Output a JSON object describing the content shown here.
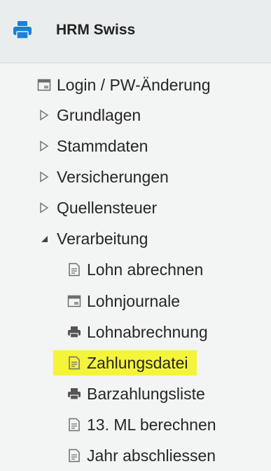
{
  "header": {
    "app_icon": "printer-icon",
    "title": "HRM Swiss",
    "accent_color": "#1f7fd6"
  },
  "menu": {
    "items": [
      {
        "label": "Login / PW-Änderung",
        "icon": "window-icon"
      },
      {
        "label": "Grundlagen",
        "icon": "triangle-right-icon"
      },
      {
        "label": "Stammdaten",
        "icon": "triangle-right-icon"
      },
      {
        "label": "Versicherungen",
        "icon": "triangle-right-icon"
      },
      {
        "label": "Quellensteuer",
        "icon": "triangle-right-icon"
      },
      {
        "label": "Verarbeitung",
        "icon": "triangle-down-icon",
        "expanded": true
      }
    ],
    "subitems": [
      {
        "label": "Lohn abrechnen",
        "icon": "document-icon"
      },
      {
        "label": "Lohnjournale",
        "icon": "window-icon"
      },
      {
        "label": "Lohnabrechnung",
        "icon": "printer-icon"
      },
      {
        "label": "Zahlungsdatei",
        "icon": "document-icon",
        "highlighted": true,
        "highlight_color": "#f4f43a"
      },
      {
        "label": "Barzahlungsliste",
        "icon": "printer-icon"
      },
      {
        "label": "13. ML berechnen",
        "icon": "document-icon"
      },
      {
        "label": "Jahr abschliessen",
        "icon": "document-icon"
      }
    ]
  }
}
